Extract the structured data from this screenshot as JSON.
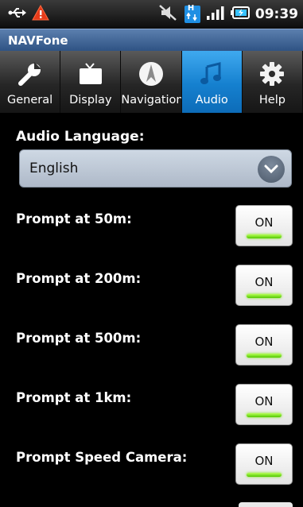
{
  "status_bar": {
    "time": "09:39",
    "icons": [
      "usb-icon",
      "warning-icon",
      "mute-icon",
      "data-network-icon",
      "signal-icon",
      "battery-icon"
    ],
    "data_badge": "H"
  },
  "app_title": "NAVFone",
  "tabs": [
    {
      "label": "General",
      "icon": "wrench-icon",
      "active": false
    },
    {
      "label": "Display",
      "icon": "tv-icon",
      "active": false
    },
    {
      "label": "Navigation",
      "icon": "compass-icon",
      "active": false
    },
    {
      "label": "Audio",
      "icon": "music-note-icon",
      "active": true
    },
    {
      "label": "Help",
      "icon": "gear-icon",
      "active": false
    }
  ],
  "audio": {
    "language_label": "Audio Language:",
    "language_value": "English",
    "prompts": [
      {
        "label": "Prompt at 50m:",
        "state": "ON"
      },
      {
        "label": "Prompt at 200m:",
        "state": "ON"
      },
      {
        "label": "Prompt at 500m:",
        "state": "ON"
      },
      {
        "label": "Prompt at 1km:",
        "state": "ON"
      },
      {
        "label": "Prompt Speed Camera:",
        "state": "ON"
      }
    ]
  },
  "colors": {
    "active_tab": "#1a8ad8",
    "title_bar": "#3e6494",
    "toggle_on": "#6fd81e"
  }
}
